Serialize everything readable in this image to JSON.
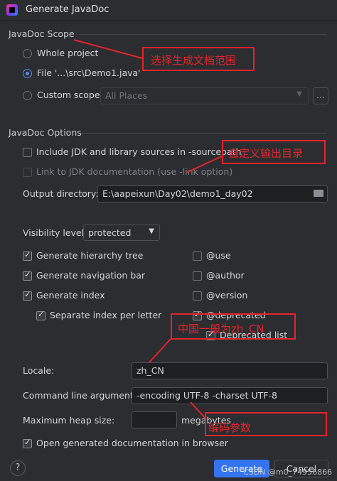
{
  "window": {
    "title": "Generate JavaDoc"
  },
  "scope": {
    "section_title": "JavaDoc Scope",
    "whole_project": "Whole project",
    "file": "File '...\\src\\Demo1.java'",
    "custom_scope": "Custom scope:",
    "custom_scope_value": "All Places",
    "ellipsis": "...",
    "selected": "file"
  },
  "options": {
    "section_title": "JavaDoc Options",
    "include_jdk": "Include JDK and library sources in -sourcepath",
    "link_jdk": "Link to JDK documentation (use -link option)",
    "output_label": "Output directory:",
    "output_value": "E:\\aapeixun\\Day02\\demo1_day02",
    "visibility_label": "Visibility level:",
    "visibility_value": "protected",
    "hierarchy": "Generate hierarchy tree",
    "navigation": "Generate navigation bar",
    "index": "Generate index",
    "separate_index": "Separate index per letter",
    "use": "@use",
    "author": "@author",
    "version": "@version",
    "deprecated": "@deprecated",
    "deprecated_list": "Deprecated list",
    "locale_label": "Locale:",
    "locale_value": "zh_CN",
    "cmd_label": "Command line arguments:",
    "cmd_value": "-encoding UTF-8 -charset UTF-8",
    "heap_label": "Maximum heap size:",
    "heap_value": "",
    "heap_unit": "megabytes",
    "open_browser": "Open generated documentation in browser"
  },
  "footer": {
    "help": "?",
    "generate": "Generate",
    "cancel": "Cancel"
  },
  "annotations": {
    "scope_note": "选择生成文档范围",
    "output_note": "自定义输出目录",
    "locale_note": "中国一般为zh_CN",
    "cmd_note": "编码参数",
    "watermark": "CSDN @m0_74956866"
  },
  "colors": {
    "accent": "#3574f0",
    "annotation": "#e3252c"
  }
}
